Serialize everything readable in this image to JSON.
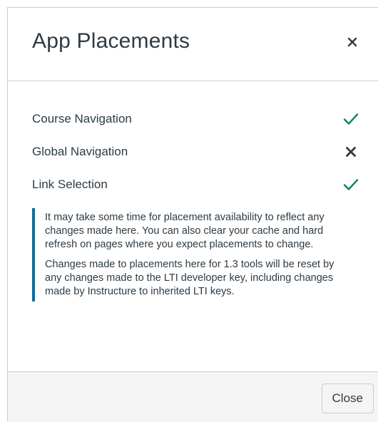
{
  "modal": {
    "title": "App Placements",
    "close_icon": "close-icon"
  },
  "placements": [
    {
      "label": "Course Navigation",
      "enabled": true,
      "icon": "check-icon"
    },
    {
      "label": "Global Navigation",
      "enabled": false,
      "icon": "x-icon"
    },
    {
      "label": "Link Selection",
      "enabled": true,
      "icon": "check-icon"
    }
  ],
  "info": {
    "paragraph_1": "It may take some time for placement availability to reflect any changes made here. You can also clear your cache and hard refresh on pages where you expect placements to change.",
    "paragraph_2": "Changes made to placements here for 1.3 tools will be reset by any changes made to the LTI developer key, including changes made by Instructure to inherited LTI keys."
  },
  "footer": {
    "close_label": "Close"
  },
  "colors": {
    "check": "#0b874b",
    "x": "#2d3b45",
    "info_accent": "#0770a3"
  }
}
